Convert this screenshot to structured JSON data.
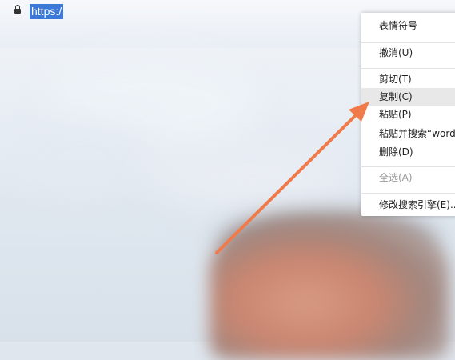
{
  "address_bar": {
    "url_text": "https:/"
  },
  "context_menu": {
    "items": [
      {
        "label": "表情符号",
        "state": "enabled"
      },
      {
        "label": "撤消(U)",
        "state": "enabled"
      },
      {
        "label": "剪切(T)",
        "state": "enabled"
      },
      {
        "label": "复制(C)",
        "state": "hovered"
      },
      {
        "label": "粘贴(P)",
        "state": "enabled"
      },
      {
        "label": "粘贴并搜索“word",
        "state": "enabled"
      },
      {
        "label": "删除(D)",
        "state": "enabled"
      },
      {
        "label": "全选(A)",
        "state": "disabled"
      },
      {
        "label": "修改搜索引擎(E)...",
        "state": "enabled"
      }
    ]
  },
  "colors": {
    "selection": "#3b78d8",
    "arrow": "#f07a4a",
    "menu_hover": "#e8e8e8"
  }
}
